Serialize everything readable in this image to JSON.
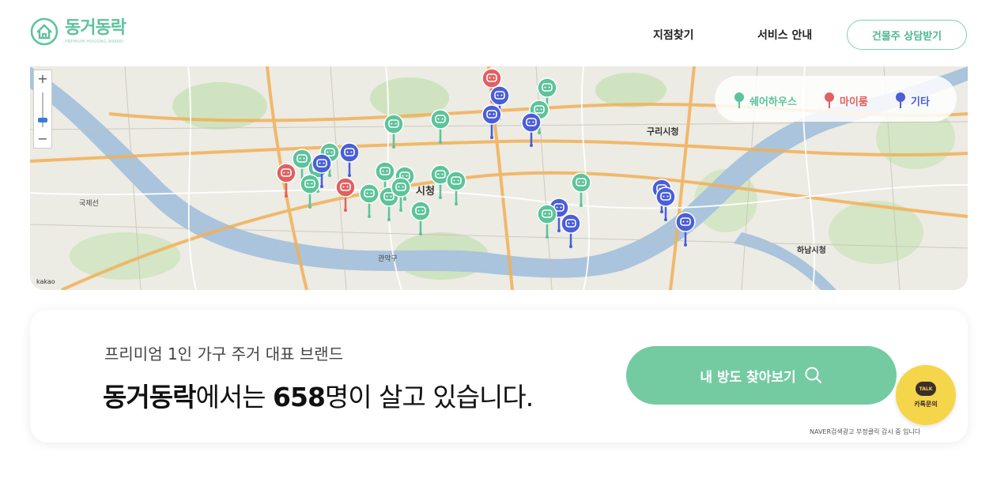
{
  "brand": {
    "name": "동거동락",
    "subtitle": "PREMIUM HOUSING BRAND",
    "color": "#5cc39a"
  },
  "nav": {
    "find_branch": "지점찾기",
    "service_info": "서비스 안내",
    "owner_consult": "건물주 상담받기"
  },
  "map": {
    "zoom_in": "+",
    "zoom_out": "−",
    "scale_label": "kakao",
    "labels": [
      "시청",
      "구리시청",
      "하남시청",
      "국제선",
      "관악구"
    ],
    "legend": [
      {
        "label": "쉐어하우스",
        "color": "#5cc39a"
      },
      {
        "label": "마이룸",
        "color": "#e26060"
      },
      {
        "label": "기타",
        "color": "#4a5ed8"
      }
    ]
  },
  "hero": {
    "subtitle": "프리미엄 1인 가구 주거 대표 브랜드",
    "brand_bold": "동거동락",
    "text_part1": "에서는 ",
    "count": "658",
    "text_part2": "명이 살고 있습니다.",
    "search_button": "내 방도 찾아보기",
    "ad_note": "NAVER검색광고 부정클릭 감시 중 입니다"
  },
  "kakao": {
    "badge": "TALK",
    "label": "카톡문의"
  }
}
